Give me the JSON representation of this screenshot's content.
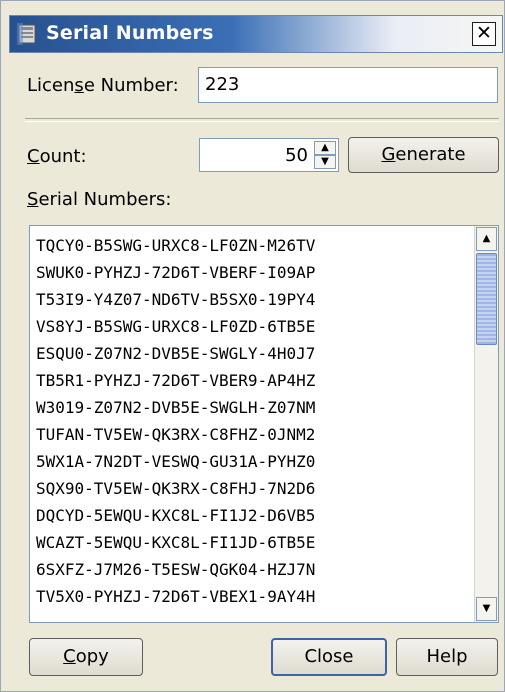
{
  "window": {
    "title": "Serial Numbers",
    "close_glyph": "✕"
  },
  "license": {
    "label": "License Number:",
    "value": "223"
  },
  "count": {
    "label": "Count:",
    "value": "50",
    "up_glyph": "▲",
    "down_glyph": "▼"
  },
  "generate": {
    "label": "Generate"
  },
  "serials": {
    "label": "Serial Numbers:",
    "items": [
      "TQCY0-B5SWG-URXC8-LF0ZN-M26TV",
      "SWUK0-PYHZJ-72D6T-VBERF-I09AP",
      "T53I9-Y4Z07-ND6TV-B5SX0-19PY4",
      "VS8YJ-B5SWG-URXC8-LF0ZD-6TB5E",
      "ESQU0-Z07N2-DVB5E-SWGLY-4H0J7",
      "TB5R1-PYHZJ-72D6T-VBER9-AP4HZ",
      "W3019-Z07N2-DVB5E-SWGLH-Z07NM",
      "TUFAN-TV5EW-QK3RX-C8FHZ-0JNM2",
      "5WX1A-7N2DT-VESWQ-GU31A-PYHZ0",
      "SQX90-TV5EW-QK3RX-C8FHJ-7N2D6",
      "DQCYD-5EWQU-KXC8L-FI1J2-D6VB5",
      "WCAZT-5EWQU-KXC8L-FI1JD-6TB5E",
      "6SXFZ-J7M26-T5ESW-QGK04-HZJ7N",
      "TV5X0-PYHZJ-72D6T-VBEX1-9AY4H"
    ],
    "scroll_up_glyph": "▲",
    "scroll_down_glyph": "▼"
  },
  "footer": {
    "copy_label": "Copy",
    "close_label": "Close",
    "help_label": "Help"
  }
}
